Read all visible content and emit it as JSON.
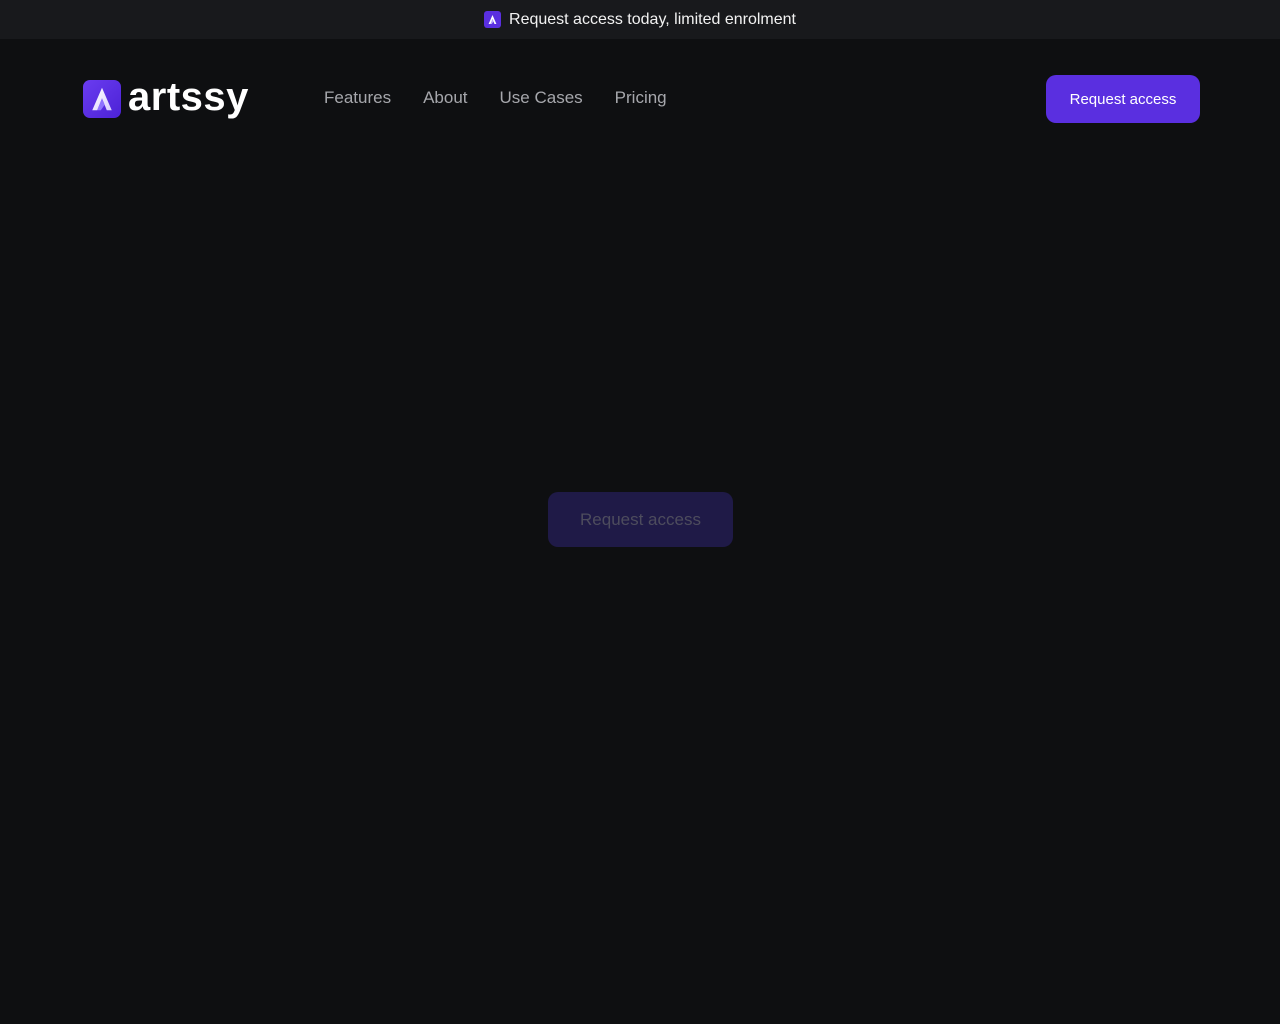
{
  "announcement": {
    "icon": "artssy-logo-icon",
    "text": "Request access today, limited enrolment"
  },
  "nav": {
    "logo_text": "artssy",
    "logo_icon": "artssy-logo-icon",
    "links": [
      "Features",
      "About",
      "Use Cases",
      "Pricing"
    ],
    "cta_label": "Request access"
  },
  "hero": {
    "cta_label": "Request access"
  },
  "colors": {
    "background": "#0e0f11",
    "announcement_bar": "#18191c",
    "accent": "#5a2fe0",
    "nav_link": "#a6a7ac",
    "hero_button_faded": "#1f1a47"
  }
}
